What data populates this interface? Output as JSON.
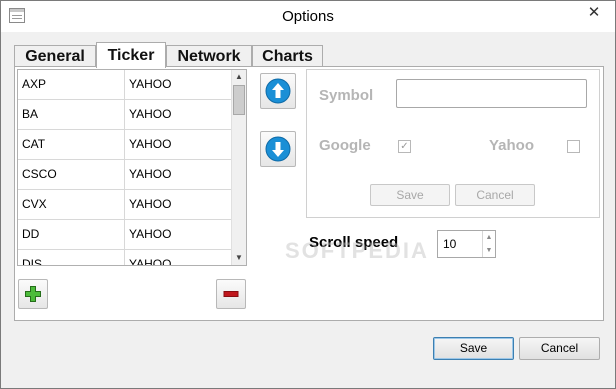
{
  "window": {
    "title": "Options",
    "close_glyph": "✕"
  },
  "tabs": [
    {
      "label": "General",
      "active": false
    },
    {
      "label": "Ticker",
      "active": true
    },
    {
      "label": "Network",
      "active": false
    },
    {
      "label": "Charts",
      "active": false
    }
  ],
  "ticker": {
    "rows": [
      {
        "symbol": "AXP",
        "source": "YAHOO"
      },
      {
        "symbol": "BA",
        "source": "YAHOO"
      },
      {
        "symbol": "CAT",
        "source": "YAHOO"
      },
      {
        "symbol": "CSCO",
        "source": "YAHOO"
      },
      {
        "symbol": "CVX",
        "source": "YAHOO"
      },
      {
        "symbol": "DD",
        "source": "YAHOO"
      },
      {
        "symbol": "DIS",
        "source": "YAHOO"
      }
    ],
    "move_up_icon": "arrow-up-icon",
    "move_down_icon": "arrow-down-icon",
    "add_icon": "plus-icon",
    "remove_icon": "minus-icon"
  },
  "form": {
    "symbol_label": "Symbol",
    "symbol_value": "",
    "google_label": "Google",
    "google_checked": true,
    "yahoo_label": "Yahoo",
    "yahoo_checked": false,
    "save_label": "Save",
    "cancel_label": "Cancel"
  },
  "scroll": {
    "label": "Scroll speed",
    "value": "10"
  },
  "footer": {
    "save_label": "Save",
    "cancel_label": "Cancel"
  },
  "watermark": "SOFTPEDIA",
  "colors": {
    "accent": "#1a8fd6",
    "add": "#3aa32a",
    "remove": "#c0171d"
  }
}
